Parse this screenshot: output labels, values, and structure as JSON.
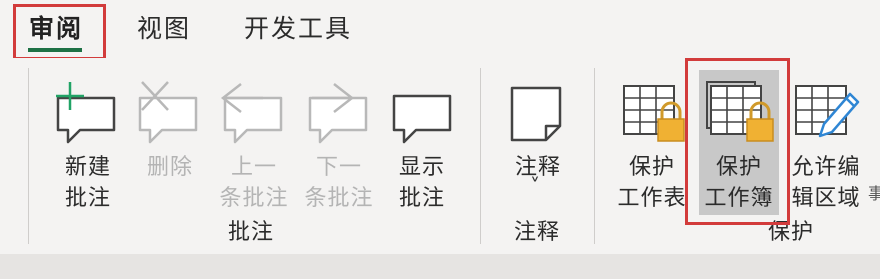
{
  "tabs": [
    {
      "label": "审阅",
      "active": true
    },
    {
      "label": "视图",
      "active": false
    },
    {
      "label": "开发工具",
      "active": false
    }
  ],
  "comments_group": {
    "label": "批注",
    "buttons": {
      "new": {
        "line1": "新建",
        "line2": "批注",
        "enabled": true
      },
      "delete": {
        "line1": "删除",
        "line2": "",
        "enabled": false
      },
      "previous": {
        "line1": "上一",
        "line2": "条批注",
        "enabled": false
      },
      "next": {
        "line1": "下一",
        "line2": "条批注",
        "enabled": false
      },
      "show": {
        "line1": "显示",
        "line2": "批注",
        "enabled": true
      }
    }
  },
  "notes_group": {
    "label": "注释",
    "buttons": {
      "notes": {
        "line1": "注释",
        "chevron": "˅"
      }
    }
  },
  "protect_group": {
    "label": "保护",
    "buttons": {
      "protect_sheet": {
        "line1": "保护",
        "line2": "工作表"
      },
      "protect_workbook": {
        "line1": "保护",
        "line2": "工作簿",
        "pressed": true
      },
      "allow_edit_ranges": {
        "line1": "允许编",
        "line2": "辑区域"
      }
    },
    "cut_off_text": "事"
  },
  "colors": {
    "accent_green": "#1e7145",
    "highlight_red": "#d23b3b",
    "lock_gold": "#f0b133",
    "pencil_blue": "#2f86d4"
  }
}
